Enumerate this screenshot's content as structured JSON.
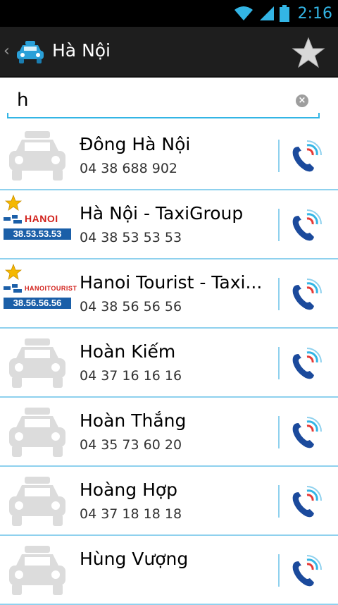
{
  "status_bar": {
    "time": "2:16",
    "icons": [
      "wifi-icon",
      "signal-icon",
      "battery-icon"
    ]
  },
  "action_bar": {
    "up_glyph": "‹",
    "title": "Hà Nội",
    "logo_icon": "taxi-icon",
    "action_icon": "favorite-star-icon"
  },
  "search": {
    "value": "h",
    "clear_icon": "clear-icon"
  },
  "colors": {
    "accent": "#33b5e5",
    "divider": "#8fd1ee",
    "actionbar": "#1e1e1e"
  },
  "list": {
    "items": [
      {
        "name": "Đông Hà Nội",
        "phone": "04 38 688 902",
        "favorite": false,
        "logo": "taxi-placeholder-icon"
      },
      {
        "name": "Hà Nội - TaxiGroup",
        "phone": "04 38 53 53 53",
        "favorite": true,
        "logo_brand": "HANOI",
        "logo_number": "38.53.53.53"
      },
      {
        "name": "Hanoi Tourist - Taxi...",
        "phone": "04 38 56 56 56",
        "favorite": true,
        "logo_brand": "HANOITOURIST",
        "logo_number": "38.56.56.56"
      },
      {
        "name": "Hoàn Kiếm",
        "phone": "04 37 16 16 16",
        "favorite": false,
        "logo": "taxi-placeholder-icon"
      },
      {
        "name": "Hoàn Thắng",
        "phone": "04 35 73 60 20",
        "favorite": false,
        "logo": "taxi-placeholder-icon"
      },
      {
        "name": "Hoàng Hợp",
        "phone": "04 37 18 18 18",
        "favorite": false,
        "logo": "taxi-placeholder-icon"
      },
      {
        "name": "Hùng Vượng",
        "phone": "",
        "favorite": false,
        "logo": "taxi-placeholder-icon"
      }
    ]
  }
}
